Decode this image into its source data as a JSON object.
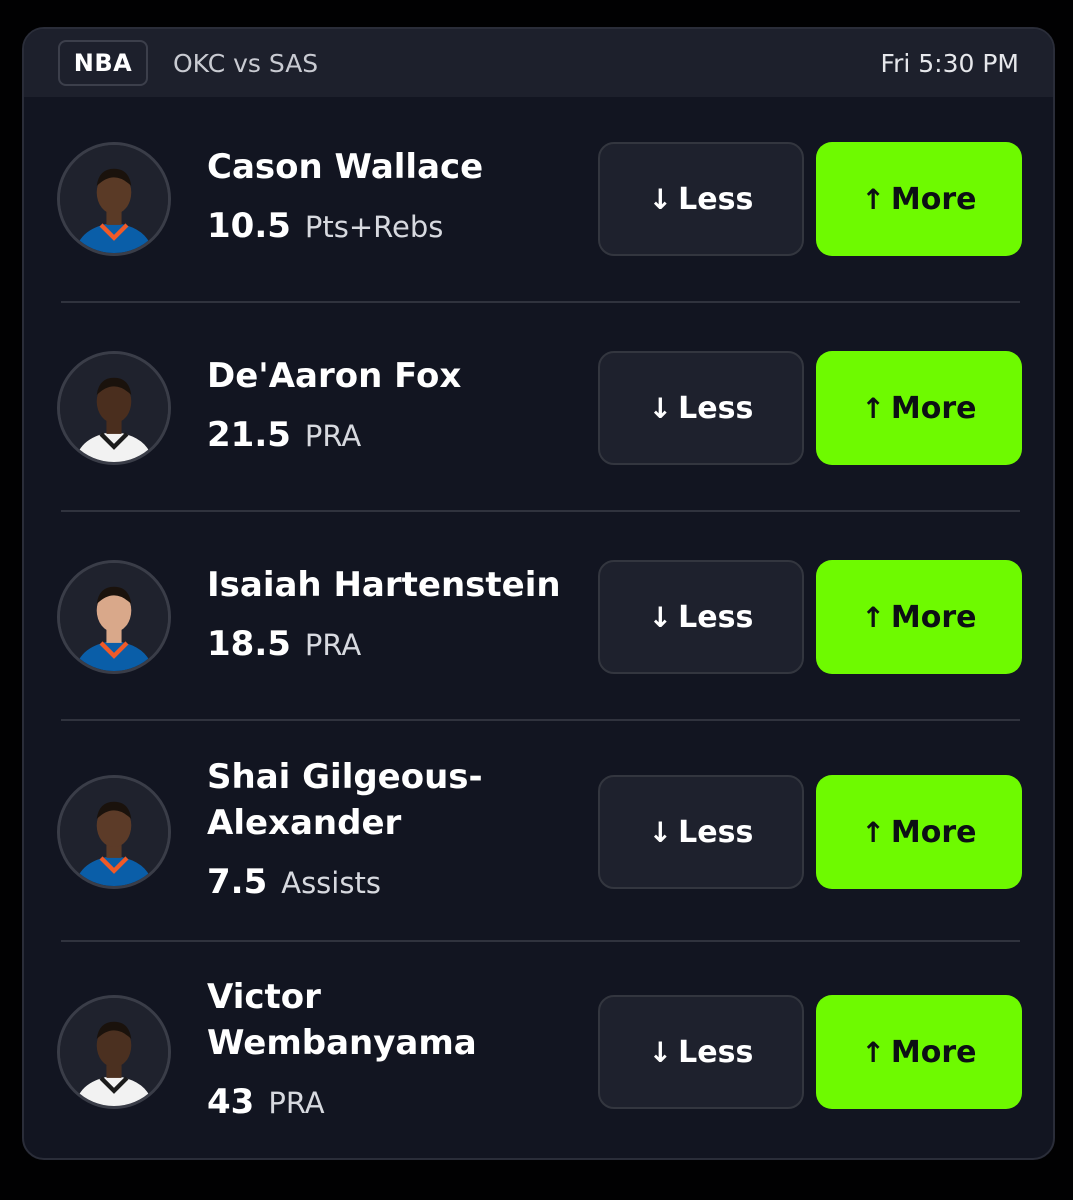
{
  "header": {
    "league": "NBA",
    "matchup": "OKC vs SAS",
    "time": "Fri 5:30 PM"
  },
  "buttons": {
    "less_label": "Less",
    "more_label": "More",
    "less_arrow": "↓",
    "more_arrow": "↑"
  },
  "colors": {
    "more_button": "#6efa00",
    "card_bg": "#121521",
    "header_bg": "#1d202c",
    "less_button": "#1e212d"
  },
  "players": [
    {
      "name": "Cason Wallace",
      "line": "10.5",
      "stat": "Pts+Rebs",
      "jersey": "okc"
    },
    {
      "name": "De'Aaron Fox",
      "line": "21.5",
      "stat": "PRA",
      "jersey": "sas"
    },
    {
      "name": "Isaiah Hartenstein",
      "line": "18.5",
      "stat": "PRA",
      "jersey": "okc"
    },
    {
      "name": "Shai Gilgeous-\nAlexander",
      "line": "7.5",
      "stat": "Assists",
      "jersey": "okc"
    },
    {
      "name": "Victor\nWembanyama",
      "line": "43",
      "stat": "PRA",
      "jersey": "sas"
    }
  ]
}
